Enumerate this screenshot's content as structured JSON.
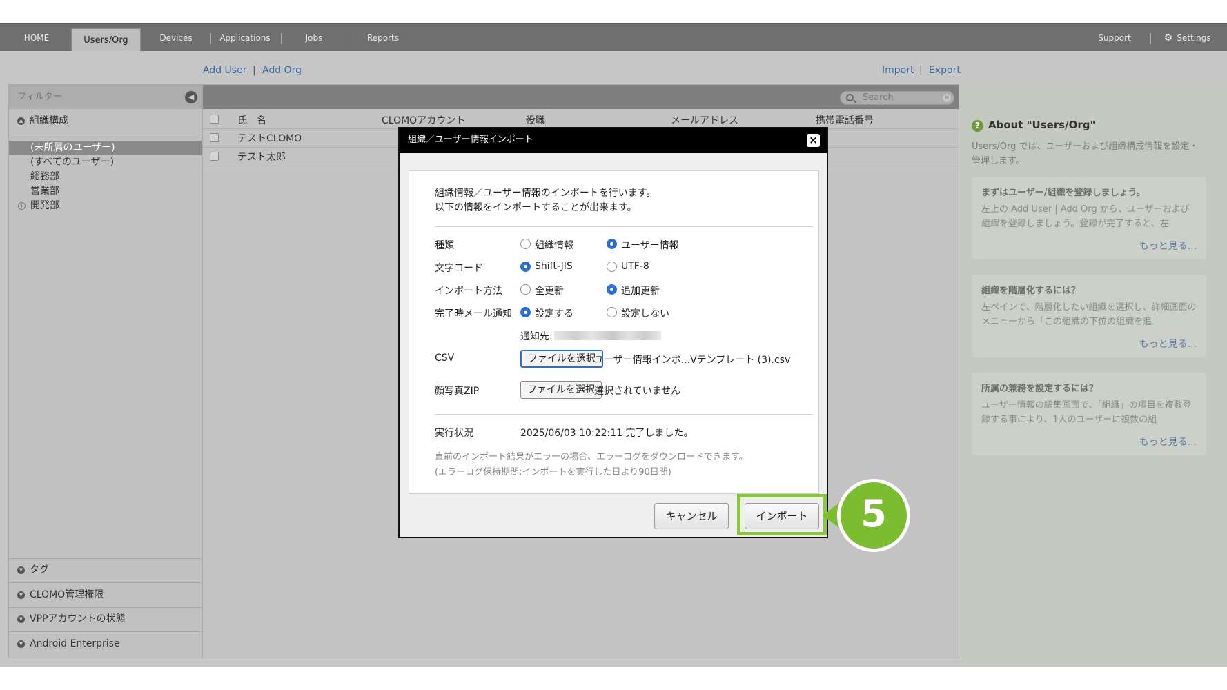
{
  "nav": {
    "tabs": [
      "HOME",
      "Users/Org",
      "Devices",
      "Applications",
      "Jobs",
      "Reports"
    ],
    "support": "Support",
    "settings": "Settings"
  },
  "toolbar": {
    "add_user": "Add User",
    "add_org": "Add Org",
    "import": "Import",
    "export": "Export",
    "separator": "|"
  },
  "filter": {
    "title": "フィルター",
    "org_section": "組織構成",
    "tree": [
      "(未所属のユーザー)",
      "(すべてのユーザー)",
      "総務部",
      "営業部",
      "開発部"
    ],
    "sections": [
      "タグ",
      "CLOMO管理権限",
      "VPPアカウントの状態",
      "Android Enterprise"
    ]
  },
  "list": {
    "search_placeholder": "Search",
    "columns": [
      "氏　名",
      "CLOMOアカウント",
      "役職",
      "メールアドレス",
      "携帯電話番号"
    ],
    "rows": [
      {
        "name": "テストCLOMO"
      },
      {
        "name": "テスト太郎"
      }
    ]
  },
  "help": {
    "title": "About \"Users/Org\"",
    "description": "Users/Org では、ユーザーおよび組織構成情報を設定・管理します。",
    "cards": [
      {
        "title": "まずはユーザー/組織を登録しましょう。",
        "body": "左上の Add User | Add Org から、ユーザーおよび組織を登録しましょう。登録が完了すると、左",
        "more": "もっと見る..."
      },
      {
        "title": "組織を階層化するには？",
        "body": "左ペインで、階層化したい組織を選択し、詳細画面のメニューから「この組織の下位の組織を追",
        "more": "もっと見る..."
      },
      {
        "title": "所属の兼務を設定するには？",
        "body": "ユーザー情報の編集画面で、「組織」の項目を複数登録する事により、1人のユーザーに複数の組",
        "more": "もっと見る..."
      }
    ]
  },
  "modal": {
    "title": "組織／ユーザー情報インポート",
    "intro1": "組織情報／ユーザー情報のインポートを行います。",
    "intro2": "以下の情報をインポートすることが出来ます。",
    "fields": {
      "kind": {
        "label": "種類",
        "options": [
          "組織情報",
          "ユーザー情報"
        ],
        "selected": "ユーザー情報"
      },
      "charset": {
        "label": "文字コード",
        "options": [
          "Shift-JIS",
          "UTF-8"
        ],
        "selected": "Shift-JIS"
      },
      "method": {
        "label": "インポート方法",
        "options": [
          "全更新",
          "追加更新"
        ],
        "selected": "追加更新"
      },
      "mail": {
        "label": "完了時メール通知",
        "options": [
          "設定する",
          "設定しない"
        ],
        "selected": "設定する"
      },
      "notify_to": "通知先:",
      "csv": {
        "label": "CSV",
        "button": "ファイルを選択",
        "file": "ユーザー情報インポ...Vテンプレート (3).csv"
      },
      "zip": {
        "label": "顔写真ZIP",
        "button": "ファイルを選択",
        "file": "選択されていません"
      }
    },
    "status_label": "実行状況",
    "status_value": "2025/06/03 10:22:11 完了しました。",
    "note1": "直前のインポート結果がエラーの場合、エラーログをダウンロードできます。",
    "note2": "(エラーログ保持期間:インポートを実行した日より90日間)",
    "cancel": "キャンセル",
    "import": "インポート"
  },
  "callout": {
    "step": "5",
    "color": "#7bbd2e"
  }
}
